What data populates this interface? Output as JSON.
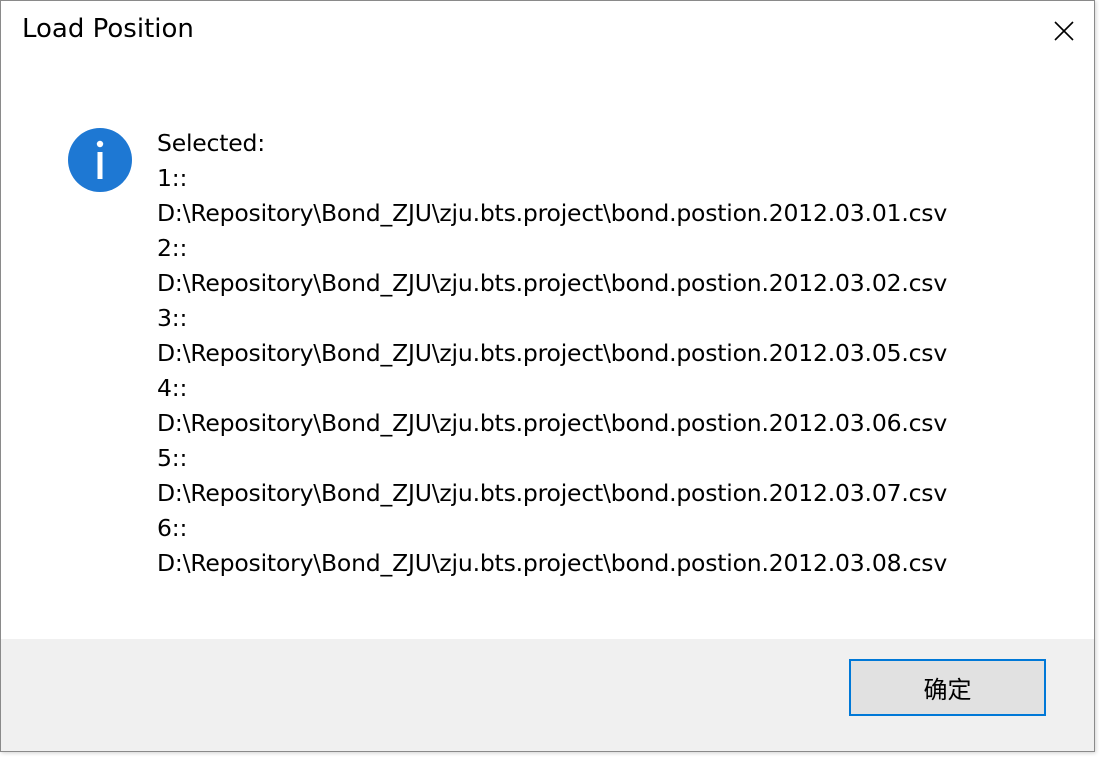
{
  "dialog": {
    "title": "Load Position",
    "icon": "info-icon",
    "message": {
      "heading": "Selected:",
      "items": [
        {
          "index": "1::",
          "path": "D:\\Repository\\Bond_ZJU\\zju.bts.project\\bond.postion.2012.03.01.csv"
        },
        {
          "index": "2::",
          "path": "D:\\Repository\\Bond_ZJU\\zju.bts.project\\bond.postion.2012.03.02.csv"
        },
        {
          "index": "3::",
          "path": "D:\\Repository\\Bond_ZJU\\zju.bts.project\\bond.postion.2012.03.05.csv"
        },
        {
          "index": "4::",
          "path": "D:\\Repository\\Bond_ZJU\\zju.bts.project\\bond.postion.2012.03.06.csv"
        },
        {
          "index": "5::",
          "path": "D:\\Repository\\Bond_ZJU\\zju.bts.project\\bond.postion.2012.03.07.csv"
        },
        {
          "index": "6::",
          "path": "D:\\Repository\\Bond_ZJU\\zju.bts.project\\bond.postion.2012.03.08.csv"
        }
      ]
    },
    "ok_label": "确定"
  },
  "colors": {
    "accent": "#0078d7",
    "icon_fill": "#1e78d3",
    "footer_bg": "#f0f0f0",
    "button_bg": "#e1e1e1"
  }
}
